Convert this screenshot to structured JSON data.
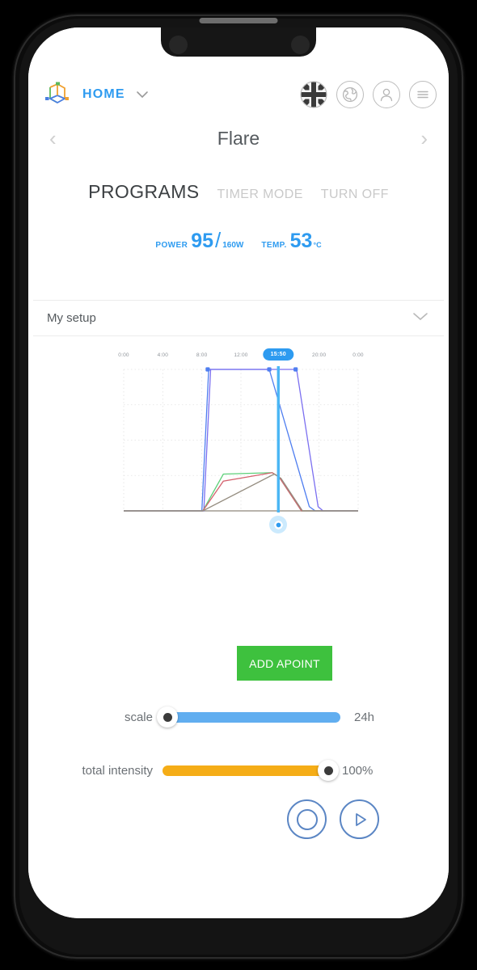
{
  "header": {
    "logo_icon": "cube-axes-logo-icon",
    "home_label": "HOME",
    "caret_icon": "chevron-down-icon",
    "icons": [
      {
        "name": "language-flag-icon",
        "label": "UK"
      },
      {
        "name": "globe-icon",
        "label": "Globe"
      },
      {
        "name": "user-account-icon",
        "label": "Account"
      },
      {
        "name": "hamburger-menu-icon",
        "label": "Menu"
      }
    ]
  },
  "title_row": {
    "prev_arrow": "‹",
    "title": "Flare",
    "next_arrow": "›"
  },
  "tabs": [
    {
      "label": "PROGRAMS",
      "active": true
    },
    {
      "label": "TIMER MODE",
      "active": false
    },
    {
      "label": "TURN OFF",
      "active": false
    }
  ],
  "readouts": {
    "power": {
      "label": "POWER",
      "value": "95",
      "separator": "/",
      "max": "160W"
    },
    "temperature": {
      "label": "TEMP.",
      "value": "53",
      "unit": "°C"
    }
  },
  "setup": {
    "label": "My setup",
    "caret_icon": "chevron-down-icon"
  },
  "chart_data": {
    "type": "line",
    "title": "",
    "xlabel": "",
    "ylabel": "",
    "grid": true,
    "legend": "none",
    "xlim": [
      0,
      24
    ],
    "ylim": [
      0,
      100
    ],
    "x_tick_labels": [
      "0:00",
      "4:00",
      "8:00",
      "12:00",
      "20:00",
      "0:00"
    ],
    "x_tick_values": [
      0,
      4,
      8,
      12,
      20,
      24
    ],
    "cursor": {
      "label": "15:50",
      "time_value": 15.83,
      "handle_icon": "chart-cursor-handle-icon"
    },
    "point_markers": [
      {
        "x": 8.6,
        "y": 100
      },
      {
        "x": 14.9,
        "y": 100
      },
      {
        "x": 17.6,
        "y": 100
      }
    ],
    "series": [
      {
        "name": "blue-channel",
        "color": "#4f7ef0",
        "x": [
          0,
          8.0,
          8.7,
          14.9,
          19.0,
          19.6,
          24
        ],
        "y": [
          0,
          0,
          100,
          100,
          3,
          0,
          0
        ]
      },
      {
        "name": "violet-channel",
        "color": "#7b6ff0",
        "x": [
          0,
          8.2,
          8.9,
          17.7,
          19.9,
          20.4,
          24
        ],
        "y": [
          0,
          0,
          100,
          100,
          3,
          0,
          0
        ]
      },
      {
        "name": "green-channel",
        "color": "#5ed07a",
        "x": [
          0,
          8.1,
          10.2,
          15.2,
          15.9,
          18.2,
          24
        ],
        "y": [
          0,
          0,
          26,
          27,
          24,
          0,
          0
        ]
      },
      {
        "name": "red-channel",
        "color": "#d4616e",
        "x": [
          0,
          8.1,
          10.2,
          15.2,
          15.9,
          18.2,
          24
        ],
        "y": [
          0,
          0,
          21,
          27,
          24,
          0,
          0
        ]
      },
      {
        "name": "warm-white-channel",
        "color": "#958d80",
        "x": [
          0,
          8.1,
          15.4,
          16.1,
          18.3,
          24
        ],
        "y": [
          0,
          0,
          26,
          23,
          0,
          0
        ]
      }
    ]
  },
  "add_point_button": {
    "line1": "ADD A",
    "line2": "POINT",
    "color": "#3ec13e"
  },
  "sliders": [
    {
      "name": "scale",
      "label": "scale",
      "value_text": "24h",
      "fill_color": "#61aef0",
      "thumb_position": "start"
    },
    {
      "name": "total-intensity",
      "label": "total intensity",
      "value_text": "100%",
      "fill_color": "#f5ad17",
      "thumb_position": "end"
    }
  ],
  "bottom_buttons": [
    {
      "name": "record-button",
      "icon": "record-circle-icon"
    },
    {
      "name": "play-button",
      "icon": "play-triangle-icon"
    }
  ]
}
